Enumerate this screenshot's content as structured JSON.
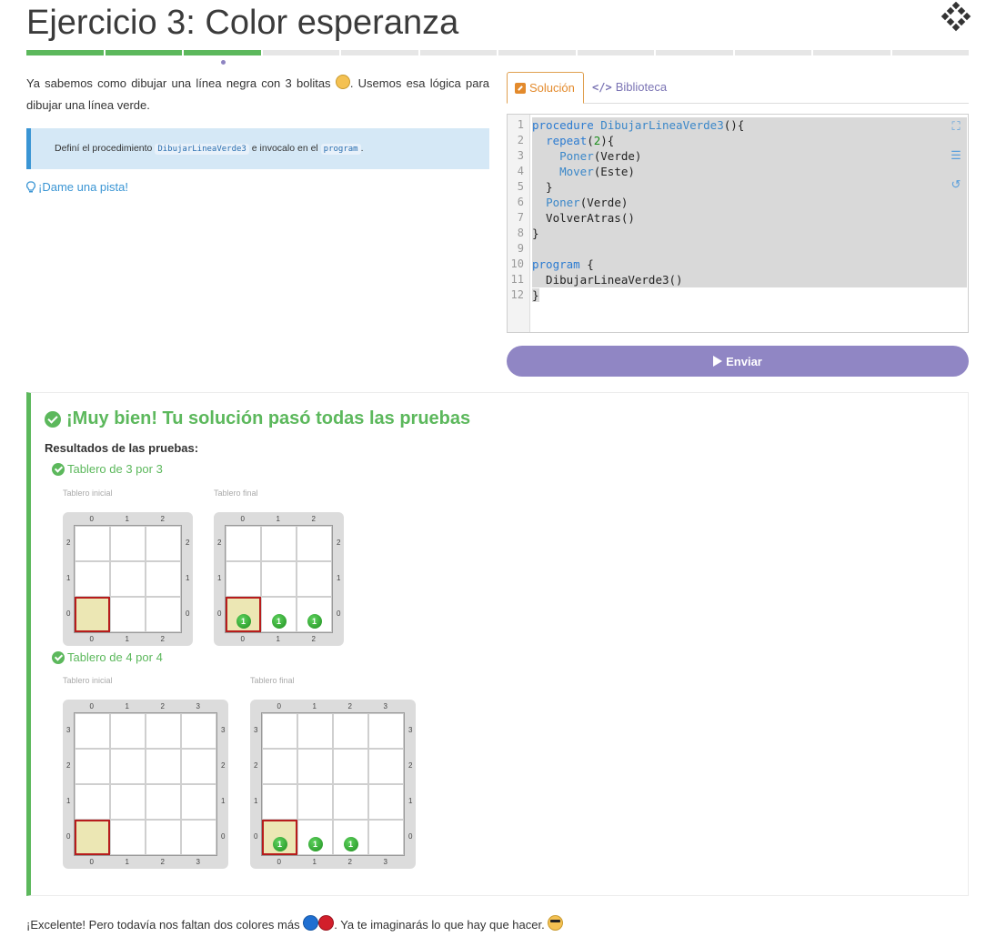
{
  "header": {
    "title": "Ejercicio 3: Color esperanza",
    "progress_total": 12,
    "progress_done": 3
  },
  "description": {
    "text_before": "Ya sabemos como dibujar una línea negra con 3 bolitas ",
    "text_after": ". Usemos esa lógica para dibujar una línea verde."
  },
  "info": {
    "text_1": "Definí el procedimiento ",
    "code_1": "DibujarLineaVerde3",
    "text_2": " e invocalo en el ",
    "code_2": "program",
    "text_3": "."
  },
  "hint": {
    "label": "¡Dame una pista!"
  },
  "tabs": {
    "solution": "Solución",
    "library": "Biblioteca"
  },
  "editor": {
    "line_numbers": [
      "1",
      "2",
      "3",
      "4",
      "5",
      "6",
      "7",
      "8",
      "9",
      "10",
      "11",
      "12"
    ]
  },
  "send": {
    "label": "Enviar"
  },
  "results": {
    "title": "¡Muy bien! Tu solución pasó todas las pruebas",
    "subtitle": "Resultados de las pruebas:",
    "initial_label": "Tablero inicial",
    "final_label": "Tablero final",
    "tests": [
      {
        "name": "Tablero de 3 por 3",
        "size": 3,
        "final_balls": [
          [
            0,
            0
          ],
          [
            1,
            0
          ],
          [
            2,
            0
          ]
        ],
        "ball_count": "1"
      },
      {
        "name": "Tablero de 4 por 4",
        "size": 4,
        "final_balls": [
          [
            0,
            0
          ],
          [
            1,
            0
          ],
          [
            2,
            0
          ]
        ],
        "ball_count": "1"
      }
    ]
  },
  "footer": {
    "text_1": "¡Excelente! Pero todavía nos faltan dos colores más ",
    "text_2": ". Ya te imaginarás lo que hay que hacer. "
  },
  "colors": {
    "green": "#5cb85c",
    "purple": "#9086c4",
    "orange": "#e38a2c",
    "blue": "#3a95d4"
  }
}
